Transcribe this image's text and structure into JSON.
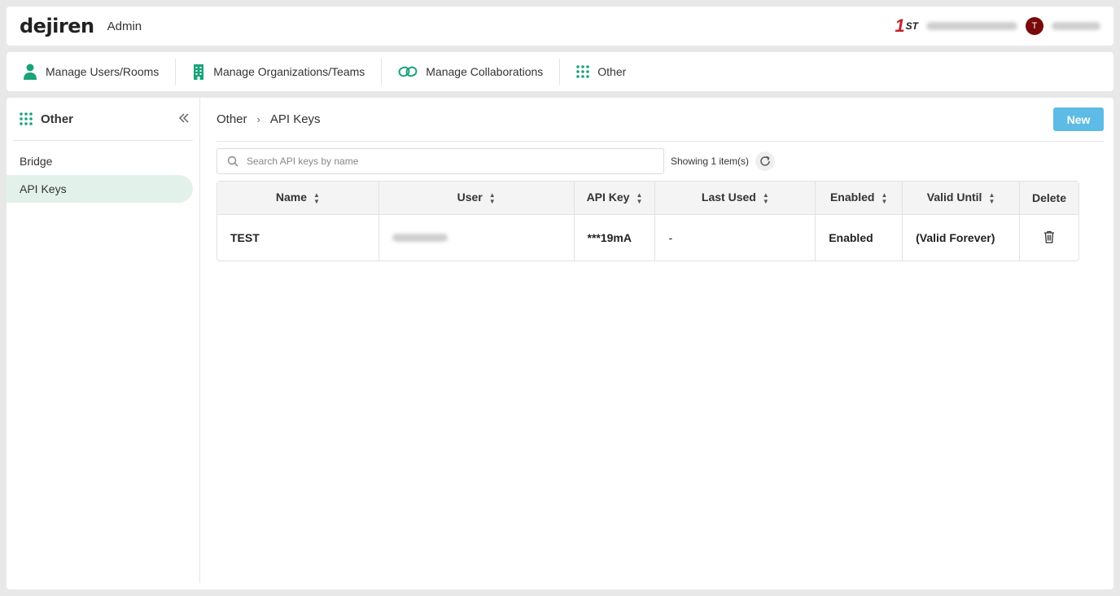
{
  "header": {
    "brand": "dejiren",
    "section": "Admin",
    "partner_logo_one": "1",
    "partner_logo_text": "ST",
    "avatar_initial": "T"
  },
  "nav": {
    "items": [
      {
        "label": "Manage Users/Rooms",
        "icon": "person-icon"
      },
      {
        "label": "Manage Organizations/Teams",
        "icon": "building-icon"
      },
      {
        "label": "Manage Collaborations",
        "icon": "link-icon"
      },
      {
        "label": "Other",
        "icon": "grid-icon"
      }
    ]
  },
  "sidebar": {
    "title": "Other",
    "items": [
      {
        "label": "Bridge",
        "active": false
      },
      {
        "label": "API Keys",
        "active": true
      }
    ]
  },
  "content": {
    "breadcrumb": [
      "Other",
      "API Keys"
    ],
    "breadcrumb_sep": "›",
    "new_button": "New",
    "search_placeholder": "Search API keys by name",
    "count_text": "Showing 1 item(s)"
  },
  "table": {
    "columns": [
      "Name",
      "User",
      "API Key",
      "Last Used",
      "Enabled",
      "Valid Until",
      "Delete"
    ],
    "rows": [
      {
        "name": "TEST",
        "user": "",
        "api_key": "***19mA",
        "last_used": "-",
        "enabled": "Enabled",
        "valid_until": "(Valid Forever)"
      }
    ]
  },
  "colors": {
    "accent_green": "#1aa37a",
    "active_bg": "#e2f2ea",
    "new_button": "#5dbbe6"
  }
}
